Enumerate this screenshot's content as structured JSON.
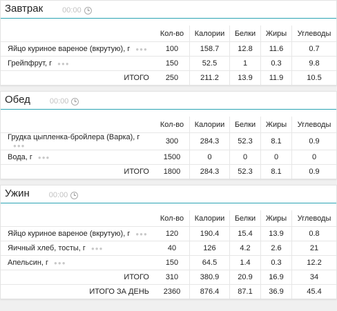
{
  "columns": {
    "qty": "Кол-во",
    "kcal": "Калории",
    "protein": "Белки",
    "fat": "Жиры",
    "carbs": "Углеводы"
  },
  "breakfast": {
    "title": "Завтрак",
    "time": "00:00",
    "items": [
      {
        "name": "Яйцо куриное вареное (вкрутую), г",
        "qty": "100",
        "kcal": "158.7",
        "protein": "12.8",
        "fat": "11.6",
        "carbs": "0.7"
      },
      {
        "name": "Грейпфрут, г",
        "qty": "150",
        "kcal": "52.5",
        "protein": "1",
        "fat": "0.3",
        "carbs": "9.8"
      }
    ],
    "total": {
      "label": "ИТОГО",
      "qty": "250",
      "kcal": "211.2",
      "protein": "13.9",
      "fat": "11.9",
      "carbs": "10.5"
    }
  },
  "lunch": {
    "title": "Обед",
    "time": "00:00",
    "items": [
      {
        "name": "Грудка цыпленка-бройлера (Варка), г",
        "qty": "300",
        "kcal": "284.3",
        "protein": "52.3",
        "fat": "8.1",
        "carbs": "0.9"
      },
      {
        "name": "Вода, г",
        "qty": "1500",
        "kcal": "0",
        "protein": "0",
        "fat": "0",
        "carbs": "0"
      }
    ],
    "total": {
      "label": "ИТОГО",
      "qty": "1800",
      "kcal": "284.3",
      "protein": "52.3",
      "fat": "8.1",
      "carbs": "0.9"
    }
  },
  "dinner": {
    "title": "Ужин",
    "time": "00:00",
    "items": [
      {
        "name": "Яйцо куриное вареное (вкрутую), г",
        "qty": "120",
        "kcal": "190.4",
        "protein": "15.4",
        "fat": "13.9",
        "carbs": "0.8"
      },
      {
        "name": "Яичный хлеб, тосты, г",
        "qty": "40",
        "kcal": "126",
        "protein": "4.2",
        "fat": "2.6",
        "carbs": "21"
      },
      {
        "name": "Апельсин, г",
        "qty": "150",
        "kcal": "64.5",
        "protein": "1.4",
        "fat": "0.3",
        "carbs": "12.2"
      }
    ],
    "total": {
      "label": "ИТОГО",
      "qty": "310",
      "kcal": "380.9",
      "protein": "20.9",
      "fat": "16.9",
      "carbs": "34"
    },
    "day_total": {
      "label": "ИТОГО ЗА ДЕНЬ",
      "qty": "2360",
      "kcal": "876.4",
      "protein": "87.1",
      "fat": "36.9",
      "carbs": "45.4"
    }
  },
  "icons": {
    "clock": "clock-icon",
    "more": "more-dots-icon"
  },
  "colors": {
    "accent": "#2aa3b3"
  }
}
